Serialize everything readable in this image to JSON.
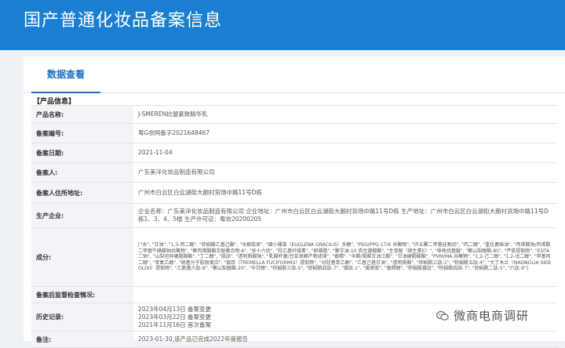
{
  "header": {
    "title": "国产普通化妆品备案信息"
  },
  "tabs": [
    {
      "label": "数据查看"
    }
  ],
  "section": {
    "title": "【产品信息】"
  },
  "rows": {
    "product_name": {
      "label": "产品名称:",
      "value": "J-SMEREN抗皱紧致精华乳"
    },
    "record_no": {
      "label": "备案编号:",
      "value": "粤G妆网备字2021648467"
    },
    "record_date": {
      "label": "备案日期:",
      "value": "2021-11-04"
    },
    "registrant": {
      "label": "备案人:",
      "value": "广东美洋化妆品制造有限公司"
    },
    "address": {
      "label": "备案人住所地址:",
      "value": "广州市白云区白云湖街大朗村货场中路11号D栋"
    },
    "manufacturer": {
      "label": "生产企业:",
      "value": "企业名称：广东美洋化妆品制造有限公司 企业地址：广州市白云区白云湖街大朗村货场中路11号D栋 生产地址：广州市白云区白云湖街大朗村货场中路11号D栋1、3、4、5楼 生产许可证：粤妆20200205"
    },
    "ingredients": {
      "label": "成分:",
      "value": "[\"水\", \"甘油\", \"1,3-丙二醇\", \"棕榈酸乙基己酯\", \"水解胶原\", \"细小裸藻（EUGLENA GRACILIS）多糖\", \"PEG/PPG-17/6 共聚物\", \"环五聚二甲基硅氧烷\", \"丙二醇\", \"氢化蓖麻油\", \"丙烯酸钠/丙烯酰二甲基牛磺酸钠共聚物\", \"聚丙烯酸酯交联聚合物-6\", \"异十六烷\", \"羟乙基纤维素\", \"卵磷脂\", \"聚甘油-10 肉豆蔻酸酯\", \"生育酚（维生素E）\", \"咪唑烷基脲\", \"聚山梨醇酯-80\", \"芦荟提取物\", \"EDTA 二钠\", \"山梨坦异硬脂酸酯\", \"丁二醇\", \"肌肽\", \"透明质酸钠\", \"乳酸杆菌/豆浆发酵产物滤液\", \"香精\", \"辛酸/癸酸甘油三酯\", \"甘油硬脂酸酯\", \"PVM/MA 共聚物\", \"1,2-己二醇\", \"1,2-戊二醇\", \"甲基丙二醇\", \"苯氧乙醇\", \"硝基分子胶原蛋白\", \"银耳（TREMELLA FUCIFORMIS）提取物\", \"对羟基苯乙酮\", \"乙基己基甘油\", \"透明质酸\", \"棕榈酰三肽-1\", \"棕榈酰五肽-4\", \"大丁木兰（MAGNOLIA SIEBOLDII）提取物\", \"乙酰基六肽-8\", \"聚山梨醇酯-20\", \"辛甘醇\", \"棕榈酰三肽-5\", \"棕榈酰四肽-7\", \"寡肽-1\", \"黄原胶\", \"香精醇\", \"棕榈酰寡肽\", \"棕榈酰四肽-7\", \"棕榈酰二肽-5\", \"六肽-9\"]"
    },
    "post_check": {
      "label": "备案后监督检查情况:",
      "value": ""
    },
    "history": {
      "label": "历史记录:",
      "items": [
        "2023年04月13日  备案变更",
        "2023年03月22日  备案变更",
        "2021年11月16日  首次备案"
      ]
    },
    "notes": {
      "label": "备注:",
      "value": "2023-01-30,该产品已完成2022年度报告"
    }
  },
  "watermark": {
    "text": "微商电商调研",
    "icon": "chat-bubble-icon"
  },
  "colors": {
    "banner": "#1a7fd2",
    "tab_active": "#1a6fc2"
  }
}
